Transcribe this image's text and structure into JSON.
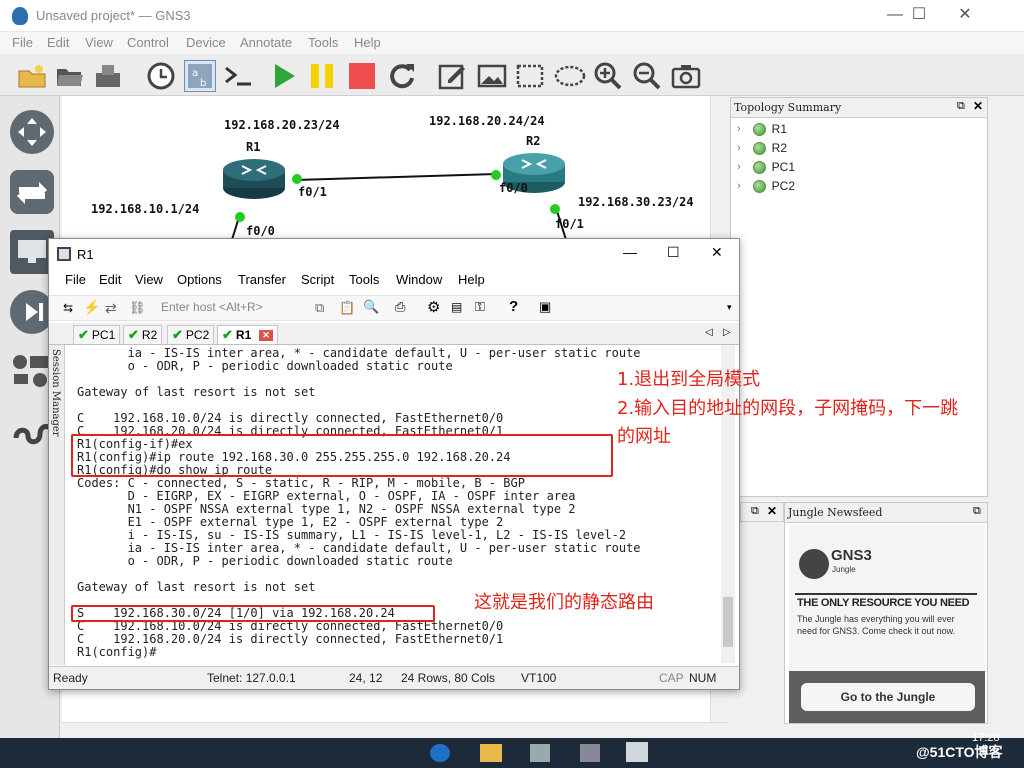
{
  "app": {
    "title": "Unsaved project* — GNS3",
    "menu": [
      "File",
      "Edit",
      "View",
      "Control",
      "Device",
      "Annotate",
      "Tools",
      "Help"
    ]
  },
  "topology": {
    "labels": {
      "r1_name": "R1",
      "r2_name": "R2",
      "r1_ip_top": "192.168.20.23/24",
      "r2_ip_top": "192.168.20.24/24",
      "r1_ip_left": "192.168.10.1/24",
      "r2_ip_right": "192.168.30.23/24",
      "r1_f01": "f0/1",
      "r1_f00": "f0/0",
      "r2_f00": "f0/0",
      "r2_f01": "f0/1"
    }
  },
  "topology_summary": {
    "title": "Topology Summary",
    "nodes": [
      "R1",
      "R2",
      "PC1",
      "PC2"
    ]
  },
  "newsfeed": {
    "title": "Jungle Newsfeed",
    "brand": "GNS3",
    "brand_sub": "Jungle",
    "headline": "THE ONLY RESOURCE YOU NEED",
    "body": "The Jungle has everything you will ever need for GNS3. Come check it out now.",
    "button": "Go to the Jungle"
  },
  "crt": {
    "title": "R1",
    "menu": [
      "File",
      "Edit",
      "View",
      "Options",
      "Transfer",
      "Script",
      "Tools",
      "Window",
      "Help"
    ],
    "host_placeholder": "Enter host <Alt+R>",
    "tabs": [
      "PC1",
      "R2",
      "PC2",
      "R1"
    ],
    "session_manager": "Session Manager",
    "terminal_lines": [
      "       ia - IS-IS inter area, * - candidate default, U - per-user static route",
      "       o - ODR, P - periodic downloaded static route",
      "",
      "Gateway of last resort is not set",
      "",
      "C    192.168.10.0/24 is directly connected, FastEthernet0/0",
      "C    192.168.20.0/24 is directly connected, FastEthernet0/1",
      "R1(config-if)#ex",
      "R1(config)#ip route 192.168.30.0 255.255.255.0 192.168.20.24",
      "R1(config)#do show ip route",
      "Codes: C - connected, S - static, R - RIP, M - mobile, B - BGP",
      "       D - EIGRP, EX - EIGRP external, O - OSPF, IA - OSPF inter area",
      "       N1 - OSPF NSSA external type 1, N2 - OSPF NSSA external type 2",
      "       E1 - OSPF external type 1, E2 - OSPF external type 2",
      "       i - IS-IS, su - IS-IS summary, L1 - IS-IS level-1, L2 - IS-IS level-2",
      "       ia - IS-IS inter area, * - candidate default, U - per-user static route",
      "       o - ODR, P - periodic downloaded static route",
      "",
      "Gateway of last resort is not set",
      "",
      "S    192.168.30.0/24 [1/0] via 192.168.20.24",
      "C    192.168.10.0/24 is directly connected, FastEthernet0/0",
      "C    192.168.20.0/24 is directly connected, FastEthernet0/1",
      "R1(config)#"
    ],
    "status": {
      "ready": "Ready",
      "telnet": "Telnet: 127.0.0.1",
      "cursor": "24,  12",
      "size": "24 Rows, 80 Cols",
      "term": "VT100",
      "cap": "CAP",
      "num": "NUM"
    }
  },
  "annotations": {
    "line1": "1.退出到全局模式",
    "line2": "2.输入目的地址的网段，子网掩码，下一跳",
    "line3": "的网址",
    "static_note": "这就是我们的静态路由"
  },
  "taskbar": {
    "time": "17:28",
    "watermark": "@51CTO博客"
  },
  "colors": {
    "accent_red": "#e0241b",
    "link_green": "#22cc22",
    "router_teal": "#2f7f86"
  }
}
